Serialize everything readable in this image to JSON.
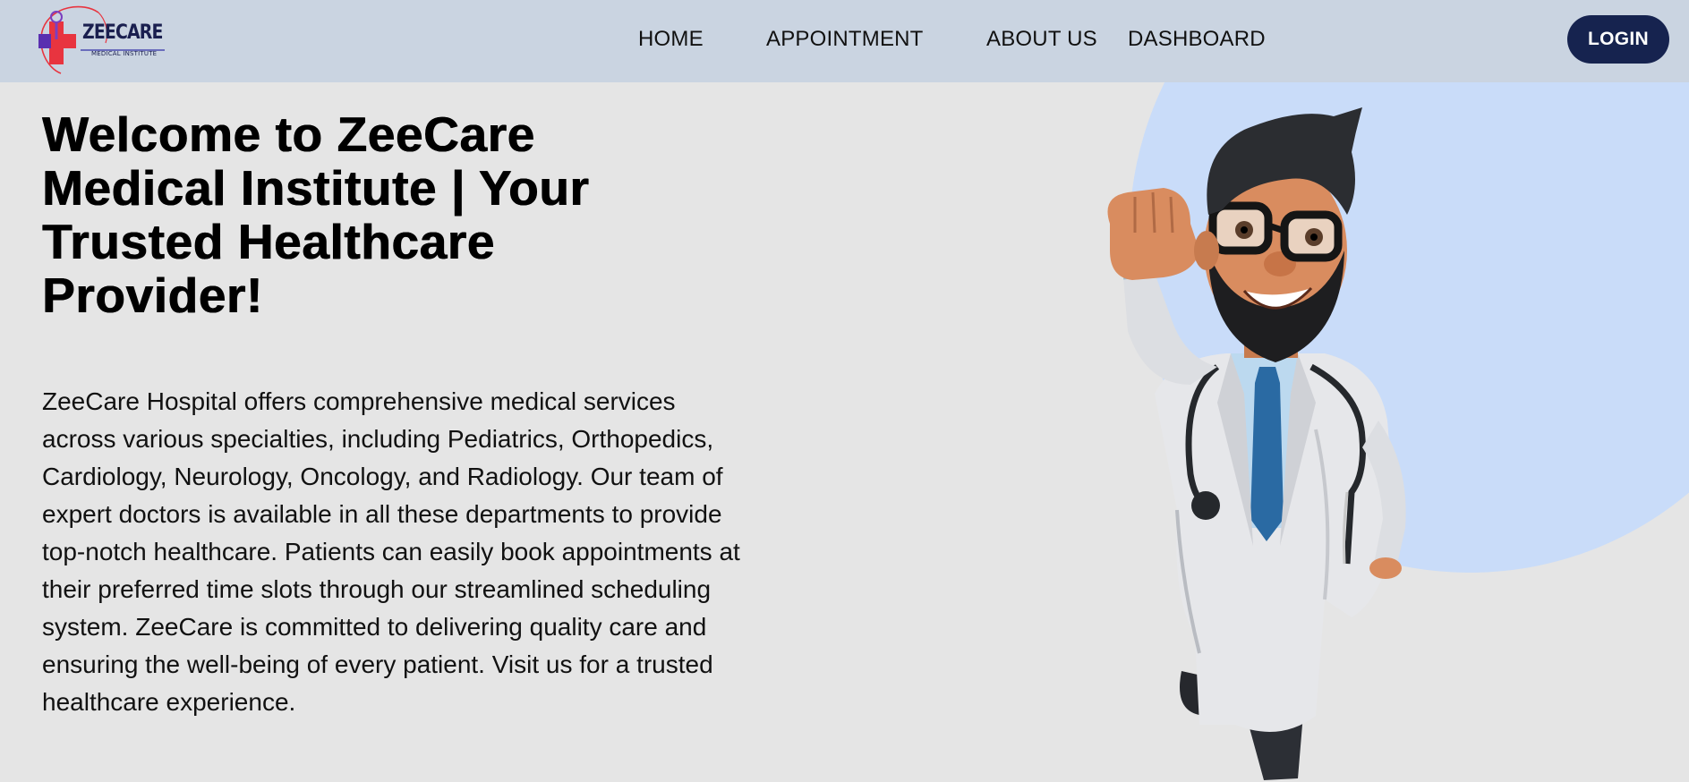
{
  "brand": {
    "name": "ZEECARE",
    "subtitle": "MEDICAL INSTITUTE",
    "colors": {
      "cross": "#e8343f",
      "ring": "#7b3fbf",
      "text": "#1a1f4f"
    }
  },
  "nav": {
    "items": [
      {
        "label": "HOME"
      },
      {
        "label": "APPOINTMENT"
      },
      {
        "label": "ABOUT US"
      },
      {
        "label": "DASHBOARD"
      }
    ],
    "login_label": "LOGIN"
  },
  "hero": {
    "title": "Welcome to ZeeCare Medical Institute | Your Trusted Healthcare Provider!",
    "description": "ZeeCare Hospital offers comprehensive medical services across various specialties, including Pediatrics, Orthopedics, Cardiology, Neurology, Oncology, and Radiology. Our team of expert doctors is available in all these departments to provide top-notch healthcare. Patients can easily book appointments at their preferred time slots through our streamlined scheduling system. ZeeCare is committed to delivering quality care and ensuring the well-being of every patient. Visit us for a trusted healthcare experience.",
    "image": "doctor-illustration"
  },
  "colors": {
    "navbar_bg": "#cad4e1",
    "page_bg": "#e5e5e5",
    "accent_circle": "#c9dcf9",
    "login_bg": "#16234f"
  }
}
